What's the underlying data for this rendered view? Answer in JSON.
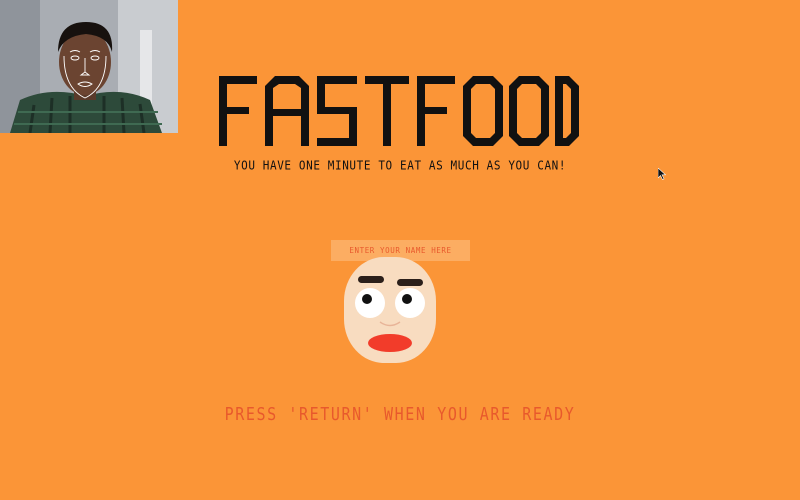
{
  "game": {
    "title": "FASTFOOD",
    "subtitle": "YOU HAVE ONE MINUTE TO EAT AS MUCH AS YOU CAN!",
    "name_input": {
      "placeholder": "ENTER YOUR NAME HERE",
      "value": ""
    },
    "prompt": "PRESS 'RETURN' WHEN YOU ARE READY"
  },
  "webcam": {
    "icon": "webcam-preview",
    "overlay": "face-landmark-overlay"
  },
  "avatar": {
    "icon": "face-avatar-icon"
  },
  "colors": {
    "background": "#fb9537",
    "title": "#111111",
    "prompt": "#e8592c",
    "input_background": "#fcad62",
    "face_skin": "#f8dcc0",
    "mouth": "#f23c2a"
  }
}
